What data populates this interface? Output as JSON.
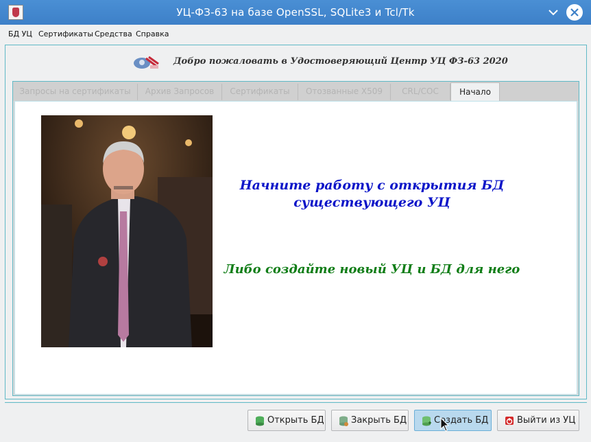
{
  "window": {
    "title": "УЦ-ФЗ-63 на базе OpenSSL, SQLite3 и Tcl/Tk"
  },
  "menu": [
    "БД УЦ",
    "Сертификаты",
    "Средства",
    "Справка"
  ],
  "header": {
    "welcome": "Добро пожаловать в Удостоверяющий Центр УЦ ФЗ-63 2020"
  },
  "tabs": [
    {
      "label": "Запросы на сертификаты",
      "active": false
    },
    {
      "label": "Архив Запросов",
      "active": false
    },
    {
      "label": "Сертификаты",
      "active": false
    },
    {
      "label": "Отозванные X509",
      "active": false
    },
    {
      "label": "CRL/СОС",
      "active": false
    },
    {
      "label": "Начало",
      "active": true
    }
  ],
  "content": {
    "line1": "Начните работу с открытия БД",
    "line2": "существующего УЦ",
    "line3": "Либо создайте новый УЦ и БД для него"
  },
  "buttons": {
    "open": "Открыть БД",
    "close": "Закрыть БД",
    "create": "Создать БД",
    "exit": "Выйти из УЦ"
  },
  "colors": {
    "accent": "#3d80c8",
    "msg_blue": "#0a14c8",
    "msg_green": "#0f7d16",
    "frame": "#5fb9c6"
  }
}
